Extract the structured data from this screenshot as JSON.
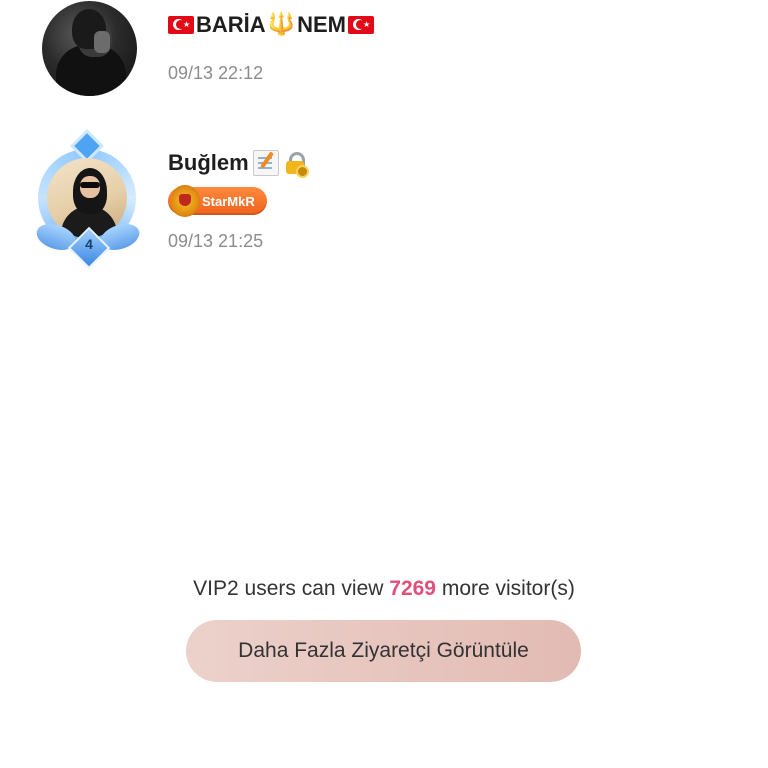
{
  "visitors": [
    {
      "name_text": "BARİA",
      "name_text2": "NEM",
      "timestamp": "09/13 22:12",
      "icons": [
        "turkish-flag-icon",
        "trident-icon",
        "turkish-flag-icon"
      ]
    },
    {
      "name_text": "Buğlem",
      "timestamp": "09/13 21:25",
      "level": "4",
      "badge": "StarMkR",
      "icons": [
        "memo-icon",
        "lock-with-key-icon"
      ]
    }
  ],
  "footer": {
    "vip_prefix": "VIP2 users can view",
    "vip_count": "7269",
    "vip_suffix": "more visitor(s)",
    "button_label": "Daha Fazla Ziyaretçi Görüntüle"
  },
  "colors": {
    "count_accent": "#e0507a",
    "badge_orange": "#f0621d",
    "button_bg": "#e2bbb3"
  }
}
